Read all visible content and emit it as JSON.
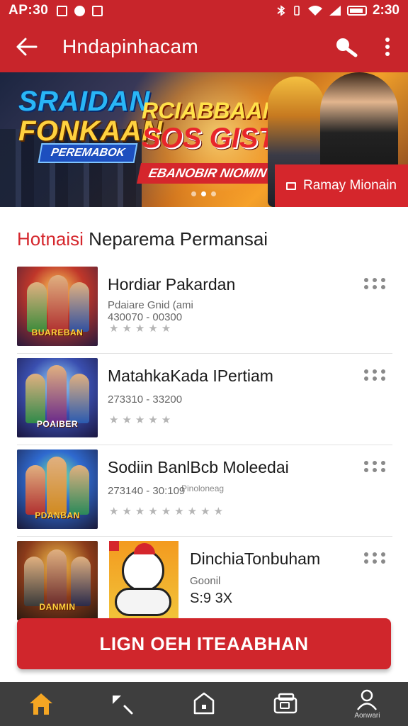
{
  "statusbar": {
    "time": "AP:30",
    "clock": "2:30"
  },
  "appbar": {
    "title": "Hndapinhacam"
  },
  "banner": {
    "headline1_line1": "SRAIDAN",
    "headline1_line2": "FONKAAN",
    "tag1": "PEREMABOK",
    "headline2_line1": "RCIABBAAN",
    "headline2_line2": "SOS GISTI",
    "tag2": "EBANOBIR NIOMIN",
    "cta_label": "Ramay Mionain",
    "active_slide": 2,
    "slide_count": 3
  },
  "section": {
    "title_accent": "Hotnaisi",
    "title_rest": " Neparema Permansai"
  },
  "games": [
    {
      "thumb_label": "BUAREBAN",
      "name": "Hordiar Pakardan",
      "sub_line1": "Pdaiare Gnid (ami",
      "sub_line2": "430070 - 00300",
      "rating_stars": "★★★★★"
    },
    {
      "thumb_label": "POAIBER",
      "name": "MatahkaKada IPertiam",
      "sub_line1": "",
      "sub_line2": "273310 - 33200",
      "rating_stars": "★★★★★"
    },
    {
      "thumb_label": "PDANBAN",
      "name": "Sodiin BanlBcb Moleedai",
      "sub_line1": "",
      "sub_line2": "273140 - 30:109",
      "tag": "Pinoloneag",
      "rating_stars": "★★★★★★★★★"
    },
    {
      "thumb_label": "DANMIN",
      "name": "DinchiaTonbuham",
      "sub_line1": "Goonil",
      "price": "S:9 3X"
    }
  ],
  "cta": {
    "label": "LIGN OEH ITEAABHAN"
  },
  "bottomnav": {
    "items": [
      {
        "icon": "home-icon",
        "label": ""
      },
      {
        "icon": "arrow-icon",
        "label": ""
      },
      {
        "icon": "shield-icon",
        "label": ""
      },
      {
        "icon": "library-icon",
        "label": ""
      },
      {
        "icon": "profile-icon",
        "label": "Aonwari"
      }
    ]
  },
  "colors": {
    "primary": "#c8252b",
    "accent": "#d5262c",
    "nav_bg": "#3e3e3e",
    "home_active": "#f5a623"
  }
}
